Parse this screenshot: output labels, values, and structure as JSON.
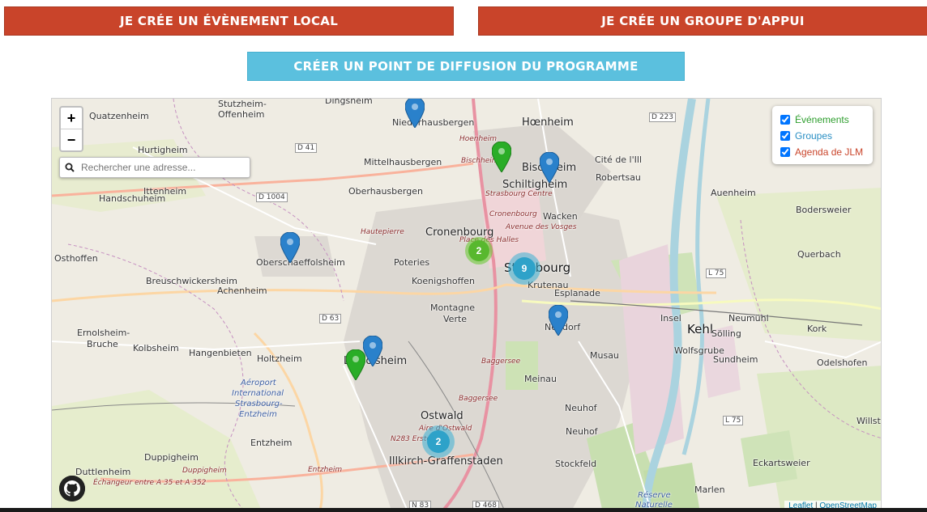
{
  "buttons": {
    "event": "JE CRÉE UN ÉVÈNEMENT LOCAL",
    "group": "JE CRÉE UN GROUPE D'APPUI",
    "diffusion": "CRÉER UN POINT DE DIFFUSION DU PROGRAMME"
  },
  "map": {
    "zoom_in": "+",
    "zoom_out": "−",
    "search_placeholder": "Rechercher une adresse...",
    "layers": [
      {
        "label": "Événements",
        "color": "#2e9e2e",
        "checked": true
      },
      {
        "label": "Groupes",
        "color": "#2a8fc4",
        "checked": true
      },
      {
        "label": "Agenda de JLM",
        "color": "#c9442a",
        "checked": true
      }
    ],
    "clusters": [
      {
        "count": "2",
        "color": "green"
      },
      {
        "count": "9",
        "color": "blue"
      },
      {
        "count": "2",
        "color": "blue"
      }
    ],
    "attribution": {
      "leaflet": "Leaflet",
      "sep": " | ",
      "osm": "OpenStreetMap"
    },
    "places": {
      "stutzheim": "Stutzheim-",
      "offenheim": "Offenheim",
      "dingsheim": "Dingsheim",
      "quatzenheim": "Quatzenheim",
      "niederhausbergen": "Niederhausbergen",
      "hoenheim": "Hœnheim",
      "hurtigheim": "Hurtigheim",
      "mittelhausbergen": "Mittelhausbergen",
      "bischheim": "Bischheim",
      "cite_ill": "Cité de l'Ill",
      "robertsau": "Robertsau",
      "schiltigheim": "Schiltigheim",
      "ittenheim": "Ittenheim",
      "oberhausbergen": "Oberhausbergen",
      "handschuheim": "Handschuheim",
      "auenheim": "Auenheim",
      "wacken": "Wacken",
      "bodersweier": "Bodersweier",
      "cronenbourg": "Cronenbourg",
      "osthoffen": "Osthoffen",
      "oberschaeffolsheim": "Oberschaeffolsheim",
      "poteries": "Poteries",
      "strasbourg": "Strasbourg",
      "querbach": "Querbach",
      "koenigshoffen": "Koenigshoffen",
      "krutenau": "Krutenau",
      "breuschwickersheim": "Breuschwickersheim",
      "achenheim": "Achenheim",
      "esplanade": "Esplanade",
      "montagne_verte": "Montagne",
      "verte": "Verte",
      "insel": "Insel",
      "neumuhl": "Neumühl",
      "ernolsheim": "Ernolsheim-",
      "bruche": "Bruche",
      "neudorf": "Neudorf",
      "kehl": "Kehl",
      "solling": "Sölling",
      "kork": "Kork",
      "kolbsheim": "Kolbsheim",
      "hangenbieten": "Hangenbieten",
      "holtzheim": "Holtzheim",
      "lingolsheim": "Lingolsheim",
      "musau": "Musau",
      "wolfsgrube": "Wolfsgrube",
      "sundheim": "Sundheim",
      "odelshofen": "Odelshofen",
      "meinau": "Meinau",
      "aeroport1": "Aéroport",
      "aeroport2": "International",
      "aeroport3": "Strasbourg-",
      "aeroport4": "Entzheim",
      "neuhof1": "Neuhof",
      "neuhof2": "Neuhof",
      "ostwald": "Ostwald",
      "willstatt": "Willstä",
      "entzheim": "Entzheim",
      "illkirch": "Illkirch-Graffenstaden",
      "duppigheim": "Duppigheim",
      "stockfeld": "Stockfeld",
      "eckartsweier": "Eckartsweier",
      "duttlenheim": "Duttlenheim",
      "marlen": "Marlen",
      "reserve": "Réserve",
      "naturelle": "Naturelle"
    },
    "roads": {
      "d223": "D 223",
      "d41": "D 41",
      "d1004": "D 1004",
      "d63": "D 63",
      "l75a": "L 75",
      "l75b": "L 75",
      "n83": "N 83",
      "d468": "D 468"
    },
    "street_labels": {
      "hautepierre": "Hautepierre",
      "strasbourg_centre": "Strasbourg Centre",
      "cronenbourg_it": "Cronenbourg",
      "avenue_vosges": "Avenue des Vosges",
      "place_halles": "Place des Halles",
      "baggersee1": "Baggersee",
      "baggersee2": "Baggersee",
      "aire_ostwald": "Aire d'Ostwald",
      "n283": "N283 Erstein",
      "duppigheim_it": "Duppigheim",
      "entzheim_it": "Entzheim",
      "echangeur": "Échangeur entre A 35 et A 352",
      "hoenheim_it": "Hoenheim",
      "bischheim_it": "Bischheim"
    }
  }
}
